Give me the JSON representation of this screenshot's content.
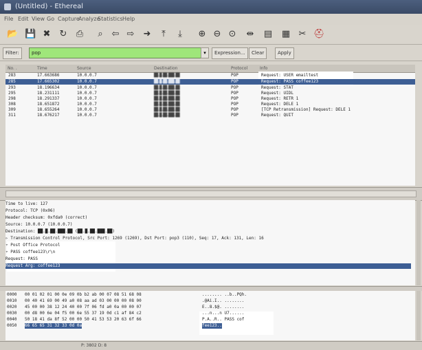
{
  "window": {
    "title": "(Untitled) - Ethereal"
  },
  "menu": [
    "File",
    "Edit",
    "View",
    "Go",
    "Capture",
    "Analyze",
    "Statistics",
    "Help"
  ],
  "toolbar_icons": [
    "open-icon",
    "save-icon",
    "close-icon",
    "reload-icon",
    "print-icon",
    "find-icon",
    "back-icon",
    "forward-icon",
    "goto-icon",
    "top-icon",
    "bottom-icon",
    "zoom-in-icon",
    "zoom-out-icon",
    "zoom-normal-icon",
    "resize-columns-icon",
    "capture-filter-icon",
    "display-filter-icon",
    "preferences-icon",
    "help-icon"
  ],
  "filter": {
    "label": "Filter:",
    "value": "pop",
    "expression_label": "Expression...",
    "clear_label": "Clear",
    "apply_label": "Apply"
  },
  "packet_list": {
    "headers": [
      "No. .",
      "Time",
      "Source",
      "Destination",
      "Protocol",
      "Info"
    ],
    "rows": [
      {
        "no": "283",
        "time": "17.663686",
        "src": "10.0.0.7",
        "dst": "██.█.██.███.██",
        "proto": "POP",
        "info": "Request: USER emailtest"
      },
      {
        "no": "285",
        "time": "17.665302",
        "src": "10.0.0.7",
        "dst": "██.█.██.███.██",
        "proto": "POP",
        "info": "Request: PASS coffee123"
      },
      {
        "no": "293",
        "time": "18.196634",
        "src": "10.0.0.7",
        "dst": "██.█.██.███.██",
        "proto": "POP",
        "info": "Request: STAT"
      },
      {
        "no": "295",
        "time": "18.231111",
        "src": "10.0.0.7",
        "dst": "██.█.██.███.██",
        "proto": "POP",
        "info": "Request: UIDL"
      },
      {
        "no": "298",
        "time": "18.291337",
        "src": "10.0.0.7",
        "dst": "██.█.██.███.██",
        "proto": "POP",
        "info": "Request: RETR 1"
      },
      {
        "no": "308",
        "time": "18.651872",
        "src": "10.0.0.7",
        "dst": "██.█.██.███.██",
        "proto": "POP",
        "info": "Request: DELE 1"
      },
      {
        "no": "309",
        "time": "18.655264",
        "src": "10.0.0.7",
        "dst": "██.█.██.███.██",
        "proto": "POP",
        "info": "[TCP Retransmission] Request: DELE 1"
      },
      {
        "no": "311",
        "time": "18.676217",
        "src": "10.0.0.7",
        "dst": "██.█.██.███.██",
        "proto": "POP",
        "info": "Request: QUIT"
      }
    ]
  },
  "details": [
    "    Time to live: 127",
    "    Protocol: TCP (0x06)",
    "    Header checksum: 0xfda0 (correct)",
    "    Source: 10.0.0.7 (10.0.0.7)",
    "    Destination: ██.█.██.███.██ (██.█.██.███.██)",
    "▹ Transmission Control Protocol, Src Port: 1269 (1269), Dst Port: pop3 (110), Seq: 17, Ack: 131, Len: 16",
    "▿ Post Office Protocol",
    "  ▿ PASS coffee123\\r\\n",
    "      Request: PASS",
    "      Request Arg: coffee123"
  ],
  "hex": [
    {
      "off": "0000",
      "bytes": "00 01 02 01 00 0e 09 0b  b2 ab 00 07 08 51 68 08",
      "ascii": "........ ..b..PQh."
    },
    {
      "off": "0010",
      "bytes": "00 40 41 69 00 49 a0 08  aa ad 03 00 00 00 08 00",
      "ascii": ".@Ai.I.. ........"
    },
    {
      "off": "0020",
      "bytes": "45 00 00 38 12 24 40 00  7f 06 fd a0 0a 00 00 07",
      "ascii": "E..8.$@. ........"
    },
    {
      "off": "0030",
      "bytes": "00 d8 00 6e 04 f5 00 6e  55 37 19 0d c1 af 84 c2",
      "ascii": "...n...n U7......"
    },
    {
      "off": "0040",
      "bytes": "50 18 41 da 8f 52 00 00  50 41 53 53 20 63 6f 66",
      "ascii": "P.A..R.. PASS cof"
    },
    {
      "off": "0050",
      "bytes": "66 65 65 31 32 33 0d 0a",
      "ascii": "fee123.."
    }
  ],
  "status": {
    "text": "P: 3802 D: 8"
  }
}
